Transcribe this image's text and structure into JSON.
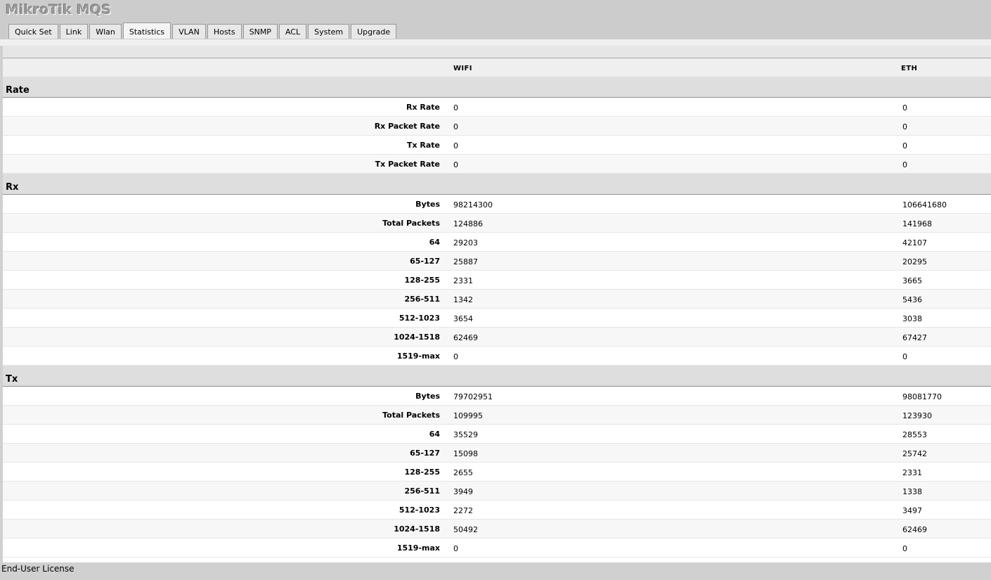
{
  "app": {
    "title": "MikroTik MQS"
  },
  "tabs": [
    {
      "label": "Quick Set"
    },
    {
      "label": "Link"
    },
    {
      "label": "Wlan"
    },
    {
      "label": "Statistics",
      "active": true
    },
    {
      "label": "VLAN"
    },
    {
      "label": "Hosts"
    },
    {
      "label": "SNMP"
    },
    {
      "label": "ACL"
    },
    {
      "label": "System"
    },
    {
      "label": "Upgrade"
    }
  ],
  "columns": {
    "wifi": "WIFI",
    "eth": "ETH"
  },
  "sections": [
    {
      "title": "Rate",
      "rows": [
        {
          "label": "Rx Rate",
          "wifi": "0",
          "eth": "0"
        },
        {
          "label": "Rx Packet Rate",
          "wifi": "0",
          "eth": "0"
        },
        {
          "label": "Tx Rate",
          "wifi": "0",
          "eth": "0"
        },
        {
          "label": "Tx Packet Rate",
          "wifi": "0",
          "eth": "0"
        }
      ]
    },
    {
      "title": "Rx",
      "rows": [
        {
          "label": "Bytes",
          "wifi": "98214300",
          "eth": "106641680"
        },
        {
          "label": "Total Packets",
          "wifi": "124886",
          "eth": "141968"
        },
        {
          "label": "64",
          "wifi": "29203",
          "eth": "42107"
        },
        {
          "label": "65-127",
          "wifi": "25887",
          "eth": "20295"
        },
        {
          "label": "128-255",
          "wifi": "2331",
          "eth": "3665"
        },
        {
          "label": "256-511",
          "wifi": "1342",
          "eth": "5436"
        },
        {
          "label": "512-1023",
          "wifi": "3654",
          "eth": "3038"
        },
        {
          "label": "1024-1518",
          "wifi": "62469",
          "eth": "67427"
        },
        {
          "label": "1519-max",
          "wifi": "0",
          "eth": "0"
        }
      ]
    },
    {
      "title": "Tx",
      "rows": [
        {
          "label": "Bytes",
          "wifi": "79702951",
          "eth": "98081770"
        },
        {
          "label": "Total Packets",
          "wifi": "109995",
          "eth": "123930"
        },
        {
          "label": "64",
          "wifi": "35529",
          "eth": "28553"
        },
        {
          "label": "65-127",
          "wifi": "15098",
          "eth": "25742"
        },
        {
          "label": "128-255",
          "wifi": "2655",
          "eth": "2331"
        },
        {
          "label": "256-511",
          "wifi": "3949",
          "eth": "1338"
        },
        {
          "label": "512-1023",
          "wifi": "2272",
          "eth": "3497"
        },
        {
          "label": "1024-1518",
          "wifi": "50492",
          "eth": "62469"
        },
        {
          "label": "1519-max",
          "wifi": "0",
          "eth": "0"
        }
      ]
    }
  ],
  "footer": {
    "license_link": "End-User License"
  }
}
